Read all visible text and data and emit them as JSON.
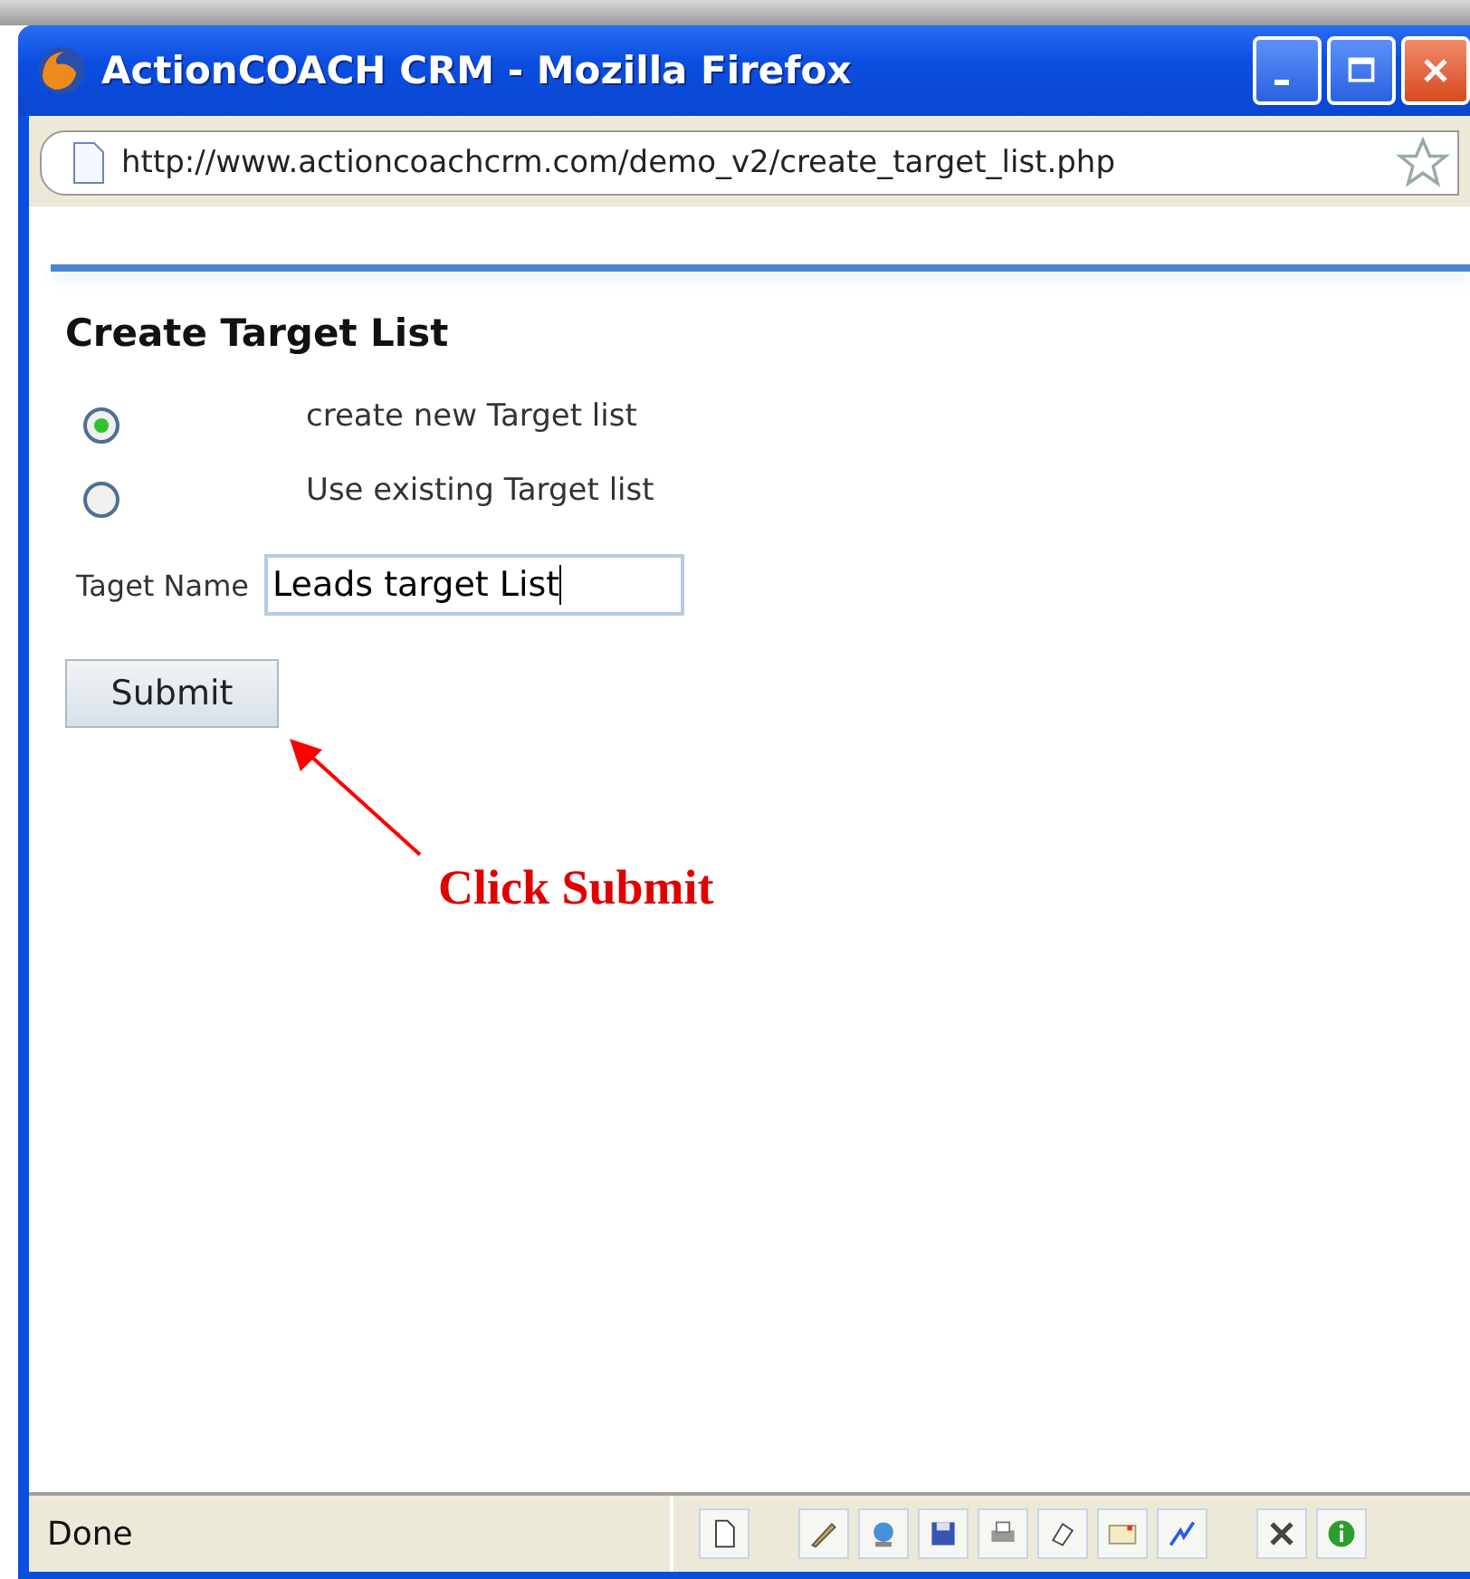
{
  "window": {
    "title": "ActionCOACH CRM - Mozilla Firefox"
  },
  "address_bar": {
    "url": "http://www.actioncoachcrm.com/demo_v2/create_target_list.php"
  },
  "form": {
    "heading": "Create Target List",
    "options": [
      {
        "label": "create new Target list",
        "selected": true
      },
      {
        "label": "Use existing Target list",
        "selected": false
      }
    ],
    "name_label": "Taget Name",
    "name_value": "Leads target List",
    "submit": "Submit"
  },
  "annotation": {
    "text": "Click Submit"
  },
  "status_bar": {
    "text": "Done"
  }
}
